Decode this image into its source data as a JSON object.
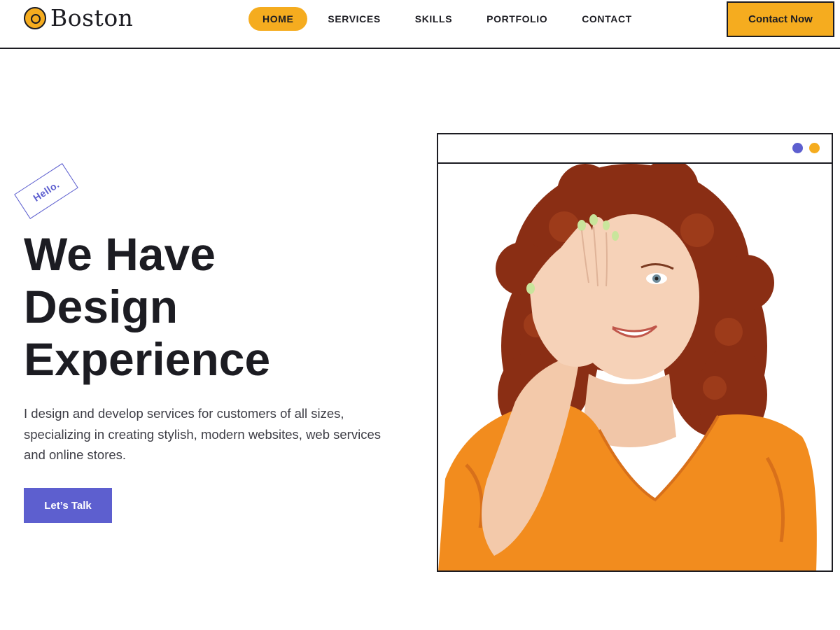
{
  "header": {
    "logo_text": "Boston",
    "logo_icon": "circle-logo-icon",
    "nav": [
      {
        "label": "HOME",
        "active": true
      },
      {
        "label": "SERVICES",
        "active": false
      },
      {
        "label": "SKILLS",
        "active": false
      },
      {
        "label": "PORTFOLIO",
        "active": false
      },
      {
        "label": "CONTACT",
        "active": false
      }
    ],
    "cta_label": "Contact Now"
  },
  "hero": {
    "tag": "Hello.",
    "title_lines": [
      "We Have",
      "Design",
      "Experience"
    ],
    "description": "I design and develop services for customers of all sizes, specializing in creating stylish, modern websites, web services and online stores.",
    "button_label": "Let’s Talk"
  },
  "frame": {
    "dots": [
      "blue-dot-icon",
      "yellow-dot-icon"
    ],
    "image": "portrait-photo-woman-covering-eye"
  },
  "colors": {
    "accent_yellow": "#f5ac1f",
    "accent_blue": "#5d5fcf",
    "text_dark": "#1c1c22",
    "shirt_orange": "#f28c1e",
    "hair_red": "#8a2e14"
  }
}
